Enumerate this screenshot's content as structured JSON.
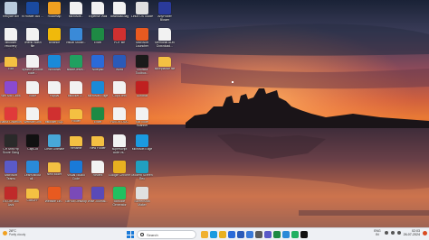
{
  "desktop": {
    "icons": [
      {
        "label": "Recycle Bin",
        "kind": "app",
        "color": "#b8cadc"
      },
      {
        "label": "bitlocker recovery credentials",
        "kind": "file",
        "color": "#f2f2f2"
      },
      {
        "label": "Edit",
        "kind": "folder",
        "color": "#f4c042"
      },
      {
        "label": "Win Mic Clock",
        "kind": "app",
        "color": "#8a4ad0"
      },
      {
        "label": "Bahut Chumkin",
        "kind": "app",
        "color": "#e03a3a"
      },
      {
        "label": "CH Mini Hp Score Gang",
        "kind": "app",
        "color": "#2a2a2a"
      },
      {
        "label": "Microsoft Teams",
        "kind": "app",
        "color": "#5a5ac8"
      },
      {
        "label": "Ex-Ore 365 Ashi",
        "kind": "app",
        "color": "#c02a2a"
      },
      {
        "label": "hi Roster 365 ...",
        "kind": "app",
        "color": "#1a4aa0"
      },
      {
        "label": "Telerik Wash file",
        "kind": "file",
        "color": "#f2f2f2"
      },
      {
        "label": "system product code...",
        "kind": "file",
        "color": "#f2f2f2"
      },
      {
        "label": "Voice",
        "kind": "file",
        "color": "#f2f2f2"
      },
      {
        "label": "Website Link",
        "kind": "file",
        "color": "#f2f2f2"
      },
      {
        "label": "CapCut",
        "kind": "app",
        "color": "#111111"
      },
      {
        "label": "Learn about all...",
        "kind": "app",
        "color": "#2a8ad8"
      },
      {
        "label": "CabOFF",
        "kind": "folder",
        "color": "#f4c042"
      },
      {
        "label": "Roadmap",
        "kind": "app",
        "color": "#f0a020"
      },
      {
        "label": "Binance",
        "kind": "app",
        "color": "#f0b90b"
      },
      {
        "label": "Windows",
        "kind": "app",
        "color": "#1a8ad8"
      },
      {
        "label": "Paypal",
        "kind": "file",
        "color": "#f2f2f2"
      },
      {
        "label": "bitlocker SQL",
        "kind": "app",
        "color": "#d03030"
      },
      {
        "label": "Clean Ultimate",
        "kind": "app",
        "color": "#48a8d8"
      },
      {
        "label": "New folder",
        "kind": "folder",
        "color": "#f4c042"
      },
      {
        "label": "Website Lin...",
        "kind": "app",
        "color": "#e85a20"
      },
      {
        "label": "Microsoft...",
        "kind": "file",
        "color": "#f2f2f2"
      },
      {
        "label": "Visual Studio...",
        "kind": "app",
        "color": "#3a8ad8"
      },
      {
        "label": "adobe-iesm...",
        "kind": "app",
        "color": "#20a060"
      },
      {
        "label": "bitlocker 2...",
        "kind": "file",
        "color": "#f2f2f2"
      },
      {
        "label": "Folder",
        "kind": "folder",
        "color": "#f4c042"
      },
      {
        "label": "Rename",
        "kind": "folder",
        "color": "#f4c042"
      },
      {
        "label": "Visual Studio Code",
        "kind": "app",
        "color": "#1a7ad8"
      },
      {
        "label": "GitHub Desktop",
        "kind": "app",
        "color": "#7a4ab8"
      },
      {
        "label": "Expense Wall",
        "kind": "file",
        "color": "#f2f2f2"
      },
      {
        "label": "Excel",
        "kind": "app",
        "color": "#1e8a44"
      },
      {
        "label": "Notepad",
        "kind": "app",
        "color": "#2a6ad8"
      },
      {
        "label": "Microsoft Edge",
        "kind": "app",
        "color": "#1a8ad8"
      },
      {
        "label": "Excel",
        "kind": "app",
        "color": "#1e8a44"
      },
      {
        "label": "New Folder",
        "kind": "folder",
        "color": "#f4c042"
      },
      {
        "label": "Recent",
        "kind": "file",
        "color": "#f2f2f2"
      },
      {
        "label": "Wise Journal...",
        "kind": "app",
        "color": "#5a4ab8"
      },
      {
        "label": "download-tag",
        "kind": "file",
        "color": "#f2f2f2"
      },
      {
        "label": "PDF file",
        "kind": "app",
        "color": "#d03030"
      },
      {
        "label": "Word",
        "kind": "app",
        "color": "#2a5ab8"
      },
      {
        "label": "Cop'd text",
        "kind": "file",
        "color": "#f2f2f2"
      },
      {
        "label": "FAVOR DOC",
        "kind": "file",
        "color": "#f2f2f2"
      },
      {
        "label": "superscript code vs...",
        "kind": "file",
        "color": "#f2f2f2"
      },
      {
        "label": "Google Chrome",
        "kind": "app",
        "color": "#e8b020"
      },
      {
        "label": "Barcode Generator",
        "kind": "app",
        "color": "#20c060"
      },
      {
        "label": "Linux OS Guide",
        "kind": "app",
        "color": "#e0e0e0"
      },
      {
        "label": "Microsoft Launcher",
        "kind": "app",
        "color": "#e85a20"
      },
      {
        "label": "Shortcut Toolbox...",
        "kind": "app",
        "color": "#1a1a1a"
      },
      {
        "label": "Acrobat",
        "kind": "app",
        "color": "#c02020"
      },
      {
        "label": "Bar code Scanner",
        "kind": "file",
        "color": "#f2f2f2"
      },
      {
        "label": "Microsoft Edge",
        "kind": "app",
        "color": "#1a9ae0"
      },
      {
        "label": "Modern Screen Rec",
        "kind": "app",
        "color": "#20a0c0"
      },
      {
        "label": "Screenshot Maker",
        "kind": "app",
        "color": "#e0e0e0"
      },
      {
        "label": "AnyPower Blower",
        "kind": "app",
        "color": "#2a3a9a"
      },
      {
        "label": "Memorial ADB Download...",
        "kind": "file",
        "color": "#f2f2f2"
      },
      {
        "label": "acceptance file",
        "kind": "folder",
        "color": "#f4c042"
      }
    ]
  },
  "taskbar": {
    "weather": {
      "temp": "28°C",
      "condition": "Partly cloudy"
    },
    "search_placeholder": "Search",
    "pinned": [
      {
        "name": "file-explorer",
        "color": "#f0b030"
      },
      {
        "name": "edge",
        "color": "#1a9ae0"
      },
      {
        "name": "chrome",
        "color": "#e8b020"
      },
      {
        "name": "mail",
        "color": "#2a6ad8"
      },
      {
        "name": "word",
        "color": "#2a5ab8"
      },
      {
        "name": "store",
        "color": "#3a7ad8"
      },
      {
        "name": "settings",
        "color": "#5a5a5a"
      },
      {
        "name": "teams",
        "color": "#5a5ac8"
      },
      {
        "name": "excel",
        "color": "#1e8a44"
      },
      {
        "name": "photos",
        "color": "#2a8ad8"
      },
      {
        "name": "spotify",
        "color": "#20b060"
      },
      {
        "name": "capcut",
        "color": "#111111"
      }
    ],
    "tray": {
      "lang_top": "ENG",
      "lang_bottom": "IN",
      "time": "02:03",
      "date": "26-07-2024"
    }
  }
}
